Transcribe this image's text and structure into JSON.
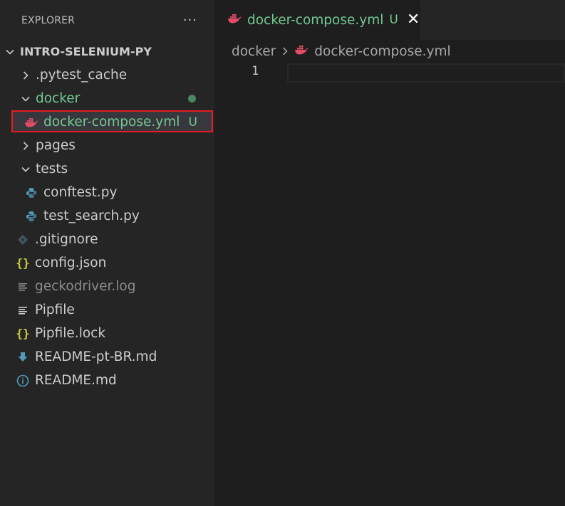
{
  "explorer": {
    "title": "EXPLORER",
    "more_actions": "···",
    "root": "INTRO-SELENIUM-PY",
    "items": [
      {
        "label": ".pytest_cache",
        "kind": "folder",
        "expanded": false
      },
      {
        "label": "docker",
        "kind": "folder",
        "expanded": true,
        "status": "modified-dot"
      },
      {
        "label": "docker-compose.yml",
        "kind": "docker-file",
        "status": "U",
        "selected": true
      },
      {
        "label": "pages",
        "kind": "folder",
        "expanded": false
      },
      {
        "label": "tests",
        "kind": "folder",
        "expanded": true
      },
      {
        "label": "conftest.py",
        "kind": "python-file"
      },
      {
        "label": "test_search.py",
        "kind": "python-file"
      },
      {
        "label": ".gitignore",
        "kind": "git-file"
      },
      {
        "label": "config.json",
        "kind": "json-file"
      },
      {
        "label": "geckodriver.log",
        "kind": "log-file",
        "ignored": true
      },
      {
        "label": "Pipfile",
        "kind": "text-file"
      },
      {
        "label": "Pipfile.lock",
        "kind": "json-file"
      },
      {
        "label": "README-pt-BR.md",
        "kind": "markdown-file"
      },
      {
        "label": "README.md",
        "kind": "info-file"
      }
    ]
  },
  "editor": {
    "tab": {
      "name": "docker-compose.yml",
      "status": "U",
      "close": "✕"
    },
    "breadcrumb": {
      "folder": "docker",
      "file": "docker-compose.yml"
    },
    "line_number": "1"
  },
  "colors": {
    "untracked_green": "#73c991",
    "selection_outline": "#e51c23",
    "docker_icon": "#e44d67",
    "python_icon": "#519aba",
    "json_icon": "#cbcb41"
  },
  "icons": {
    "folder_closed": "chevron-right-icon",
    "folder_open": "chevron-down-icon",
    "docker": "docker-whale-icon",
    "python": "python-icon",
    "git": "git-icon",
    "json": "json-braces-icon",
    "log": "lines-icon",
    "markdown": "download-arrow-icon",
    "info": "info-icon"
  }
}
